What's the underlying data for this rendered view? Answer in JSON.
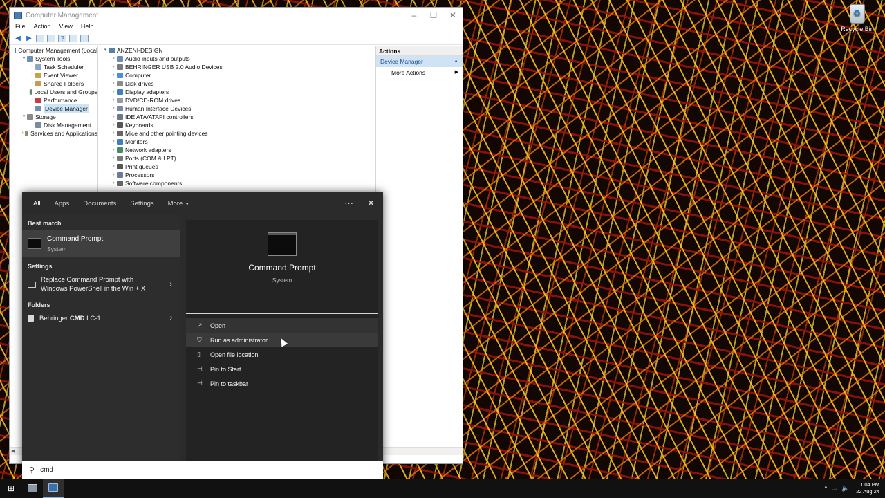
{
  "desktop": {
    "recycle_bin_label": "Recycle Bin"
  },
  "computer_management": {
    "title": "Computer Management",
    "menu": [
      "File",
      "Action",
      "View",
      "Help"
    ],
    "tree": [
      {
        "label": "Computer Management (Local",
        "level": 0,
        "expand": ""
      },
      {
        "label": "System Tools",
        "level": 1,
        "expand": "▾"
      },
      {
        "label": "Task Scheduler",
        "level": 2,
        "expand": "›"
      },
      {
        "label": "Event Viewer",
        "level": 2,
        "expand": "›"
      },
      {
        "label": "Shared Folders",
        "level": 2,
        "expand": "›"
      },
      {
        "label": "Local Users and Groups",
        "level": 2,
        "expand": "›"
      },
      {
        "label": "Performance",
        "level": 2,
        "expand": "›"
      },
      {
        "label": "Device Manager",
        "level": 2,
        "expand": "",
        "selected": true
      },
      {
        "label": "Storage",
        "level": 1,
        "expand": "▾"
      },
      {
        "label": "Disk Management",
        "level": 2,
        "expand": ""
      },
      {
        "label": "Services and Applications",
        "level": 1,
        "expand": "›"
      }
    ],
    "device_root": "ANZENI-DESIGN",
    "devices": [
      "Audio inputs and outputs",
      "BEHRINGER USB 2.0 Audio Devices",
      "Computer",
      "Disk drives",
      "Display adapters",
      "DVD/CD-ROM drives",
      "Human Interface Devices",
      "IDE ATA/ATAPI controllers",
      "Keyboards",
      "Mice and other pointing devices",
      "Monitors",
      "Network adapters",
      "Ports (COM & LPT)",
      "Print queues",
      "Processors",
      "Software components"
    ],
    "actions": {
      "header": "Actions",
      "selected": "Device Manager",
      "more": "More Actions"
    }
  },
  "search_panel": {
    "tabs": [
      "All",
      "Apps",
      "Documents",
      "Settings",
      "More"
    ],
    "more_icon": "ellipsis-icon",
    "close_icon": "close-icon",
    "best_match_heading": "Best match",
    "best_match": {
      "title": "Command Prompt",
      "subtitle": "System"
    },
    "settings_heading": "Settings",
    "settings_item": "Replace Command Prompt with Windows PowerShell in the Win + X",
    "folders_heading": "Folders",
    "folder_item_prefix": "Behringer ",
    "folder_item_bold": "CMD",
    "folder_item_suffix": " LC-1",
    "preview": {
      "title": "Command Prompt",
      "subtitle": "System"
    },
    "actions": [
      {
        "label": "Open",
        "icon": "open-icon"
      },
      {
        "label": "Run as administrator",
        "icon": "shield-icon"
      },
      {
        "label": "Open file location",
        "icon": "file-icon"
      },
      {
        "label": "Pin to Start",
        "icon": "pin-icon"
      },
      {
        "label": "Pin to taskbar",
        "icon": "pin-icon"
      }
    ],
    "query": "cmd"
  },
  "taskbar": {
    "time": "1:04 PM",
    "date": "22 Aug 24"
  }
}
